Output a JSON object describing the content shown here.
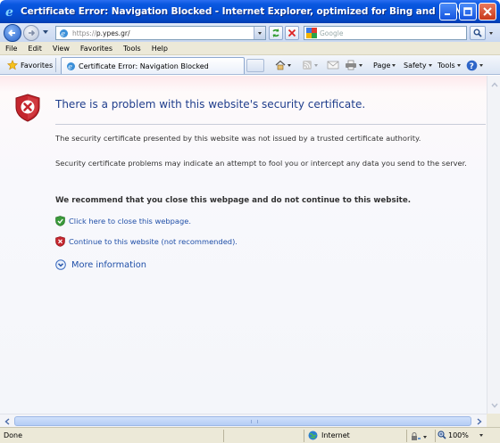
{
  "window": {
    "title": "Certificate Error: Navigation Blocked - Internet Explorer, optimized for Bing and MSN"
  },
  "address": {
    "url_prefix": "https://",
    "url_host": "p.ypes.gr/"
  },
  "search": {
    "placeholder": "Google"
  },
  "menu": {
    "items": [
      "File",
      "Edit",
      "View",
      "Favorites",
      "Tools",
      "Help"
    ]
  },
  "favorites_bar": {
    "favorites_label": "Favorites",
    "tab_title": "Certificate Error: Navigation Blocked"
  },
  "command_bar": {
    "page_label": "Page",
    "safety_label": "Safety",
    "tools_label": "Tools"
  },
  "page": {
    "headline": "There is a problem with this website's security certificate.",
    "para1": "The security certificate presented by this website was not issued by a trusted certificate authority.",
    "para2": "Security certificate problems may indicate an attempt to fool you or intercept any data you send to the server.",
    "recommendation": "We recommend that you close this webpage and do not continue to this website.",
    "close_link": "Click here to close this webpage.",
    "continue_link": "Continue to this website (not recommended).",
    "more_info": "More information"
  },
  "status": {
    "text": "Done",
    "zone": "Internet",
    "zoom": "100%"
  },
  "colors": {
    "title_bar": "#0450d8",
    "link": "#1f4fa8",
    "headline": "#1f3e8c",
    "shield_red": "#c4262e"
  }
}
